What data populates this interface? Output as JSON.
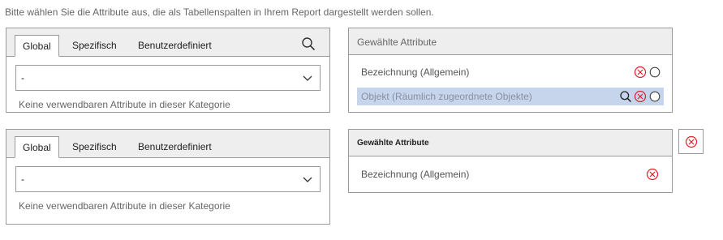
{
  "instruction": "Bitte wählen Sie die Attribute aus, die als Tabellenspalten in Ihrem Report dargestellt werden sollen.",
  "tabs": [
    "Global",
    "Spezifisch",
    "Benutzerdefiniert"
  ],
  "pickers": [
    {
      "active_tab": "Global",
      "select_value": "-",
      "empty_note": "Keine verwendbaren Attribute in dieser Kategorie"
    },
    {
      "active_tab": "Global",
      "select_value": "-",
      "empty_note": "Keine verwendbaren Attribute in dieser Kategorie"
    }
  ],
  "selected_panels": [
    {
      "title": "Gewählte Attribute",
      "items": [
        {
          "label": "Bezeichnung (Allgemein)",
          "highlighted": false
        },
        {
          "label": "Objekt (Räumlich zugeordnete Objekte)",
          "highlighted": true
        }
      ]
    },
    {
      "title": "Gewählte Attribute",
      "items": [
        {
          "label": "Bezeichnung (Allgemein)",
          "highlighted": false
        }
      ]
    }
  ],
  "colors": {
    "remove_red": "#e0202a",
    "highlight_row": "#c7d5ec",
    "header_bg": "#eeeeee",
    "border": "#9a9a9a"
  },
  "icons": [
    "search-icon",
    "chevron-down-icon",
    "remove-circle-icon",
    "radio-circle-icon"
  ]
}
